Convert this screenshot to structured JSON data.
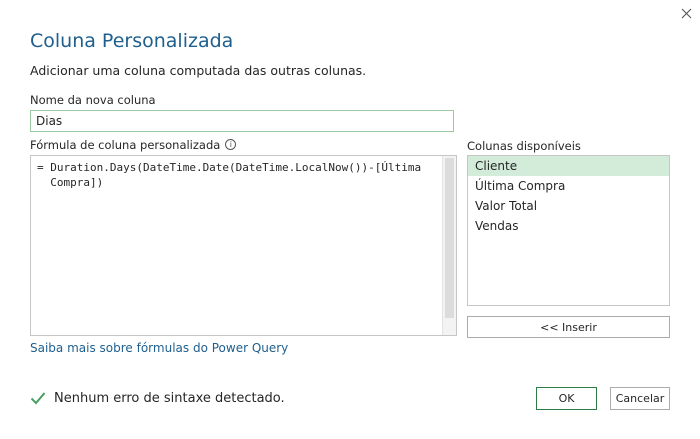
{
  "dialog": {
    "title": "Coluna Personalizada",
    "subtitle": "Adicionar uma coluna computada das outras colunas."
  },
  "new_column": {
    "label": "Nome da nova coluna",
    "value": "Dias"
  },
  "formula": {
    "label": "Fórmula de coluna personalizada",
    "info_icon": "info-icon",
    "line1": "= Duration.Days(DateTime.Date(DateTime.LocalNow())-[Última",
    "line2": "  Compra])"
  },
  "available_columns": {
    "label": "Colunas disponíveis",
    "items": [
      {
        "label": "Cliente",
        "selected": true
      },
      {
        "label": "Última Compra",
        "selected": false
      },
      {
        "label": "Valor Total",
        "selected": false
      },
      {
        "label": "Vendas",
        "selected": false
      }
    ],
    "insert_label": "<< Inserir"
  },
  "help_link": "Saiba mais sobre fórmulas do Power Query",
  "status": {
    "text": "Nenhum erro de sintaxe detectado.",
    "icon": "checkmark-icon",
    "color": "#4a9e63"
  },
  "buttons": {
    "ok": "OK",
    "cancel": "Cancelar"
  },
  "colors": {
    "accent": "#1f5f8e",
    "selected_bg": "#d3ecd9",
    "ok_border": "#2d7c46"
  }
}
